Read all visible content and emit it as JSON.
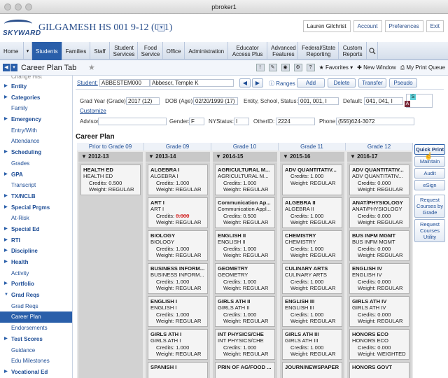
{
  "window": {
    "title": "pbroker1"
  },
  "header": {
    "app_name": "GILGAMESH HS 001 9-12 (001)",
    "logo": "SKYWARD",
    "user": "Lauren Gilchrist",
    "links": [
      "Account",
      "Preferences",
      "Exit"
    ]
  },
  "nav": {
    "tabs": [
      {
        "label": "Home",
        "active": false
      },
      {
        "label": "Students",
        "active": true
      },
      {
        "label": "Families",
        "active": false
      },
      {
        "label": "Staff",
        "active": false
      },
      {
        "label": "Student Services",
        "active": false
      },
      {
        "label": "Food Service",
        "active": false
      },
      {
        "label": "Office",
        "active": false
      },
      {
        "label": "Administration",
        "active": false
      },
      {
        "label": "Educator Access Plus",
        "active": false
      },
      {
        "label": "Advanced Features",
        "active": false
      },
      {
        "label": "Federal/State Reporting",
        "active": false
      },
      {
        "label": "Custom Reports",
        "active": false
      }
    ],
    "search_icon": "search-icon"
  },
  "pagebar": {
    "title": "Career Plan Tab",
    "favorites": "Favorites",
    "new_window": "New Window",
    "print_queue": "My Print Queue"
  },
  "sidebar": {
    "items": [
      {
        "label": "Change Hist",
        "type": "cut"
      },
      {
        "label": "Entity",
        "type": "grp"
      },
      {
        "label": "Categories",
        "type": "grp"
      },
      {
        "label": "Family",
        "type": "item"
      },
      {
        "label": "Emergency",
        "type": "grp"
      },
      {
        "label": "Entry/With",
        "type": "item"
      },
      {
        "label": "Attendance",
        "type": "item"
      },
      {
        "label": "Scheduling",
        "type": "grp"
      },
      {
        "label": "Grades",
        "type": "item"
      },
      {
        "label": "GPA",
        "type": "grp"
      },
      {
        "label": "Transcript",
        "type": "item"
      },
      {
        "label": "TX/NCLB",
        "type": "grp"
      },
      {
        "label": "Special Prgms",
        "type": "grp"
      },
      {
        "label": "At-Risk",
        "type": "item"
      },
      {
        "label": "Special Ed",
        "type": "grp"
      },
      {
        "label": "RTI",
        "type": "grp"
      },
      {
        "label": "Discipline",
        "type": "grp"
      },
      {
        "label": "Health",
        "type": "grp"
      },
      {
        "label": "Activity",
        "type": "item"
      },
      {
        "label": "Portfolio",
        "type": "grp"
      },
      {
        "label": "Grad Reqs",
        "type": "open"
      },
      {
        "label": "Grad Reqs",
        "type": "sub"
      },
      {
        "label": "Career Plan",
        "type": "sel"
      },
      {
        "label": "Endorsements",
        "type": "sub"
      },
      {
        "label": "Test Scores",
        "type": "grp"
      },
      {
        "label": "Guidance",
        "type": "item"
      },
      {
        "label": "Edu Milestones",
        "type": "item"
      },
      {
        "label": "Vocational Ed",
        "type": "grp"
      }
    ]
  },
  "student": {
    "label": "Student:",
    "id": "ABBESTEM000",
    "name": "Abbescr, Temple K",
    "ranges": "Ranges",
    "buttons": [
      "Add",
      "Delete",
      "Transfer",
      "Pseudo"
    ],
    "grad_year_label": "Grad Year (Grade):",
    "grad_year": "2017 (12)",
    "dob_label": "DOB (Age):",
    "dob": "02/20/1999 (17)",
    "entity_label": "Entity, School, Status:",
    "entity": "001, 001, I",
    "default_label": "Default:",
    "default": "041, 041, I",
    "customize": "Customize",
    "advisor_label": "Advisor:",
    "advisor": "",
    "gender_label": "Gender:",
    "gender": "F",
    "nystatus_label": "NYStatus:",
    "nystatus": "I",
    "otherid_label": "OtherID:",
    "otherid": "2224",
    "phone_label": "Phone:",
    "phone": "(555)624-3072",
    "badge_s": "S",
    "badge_a": "A"
  },
  "career_plan": {
    "title": "Career Plan",
    "columns": [
      {
        "header": "Prior to Grade 09",
        "year": "2012-13",
        "courses": [
          {
            "name": "HEALTH ED",
            "sub": "HEALTH ED",
            "credits": "0.500",
            "weight": "REGULAR",
            "strike": false
          }
        ]
      },
      {
        "header": "Grade 09",
        "year": "2013-14",
        "courses": [
          {
            "name": "ALGEBRA I",
            "sub": "ALGEBRA I",
            "credits": "1.000",
            "weight": "REGULAR",
            "strike": false
          },
          {
            "name": "ART I",
            "sub": "ART I",
            "credits": "0.000",
            "weight": "REGULAR",
            "strike": true
          },
          {
            "name": "BIOLOGY",
            "sub": "BIOLOGY",
            "credits": "1.000",
            "weight": "REGULAR",
            "strike": false
          },
          {
            "name": "BUSINESS INFORM...",
            "sub": "BUSINESS INFORM...",
            "credits": "1.000",
            "weight": "REGULAR",
            "strike": false
          },
          {
            "name": "ENGLISH I",
            "sub": "ENGLISH I",
            "credits": "1.000",
            "weight": "REGULAR",
            "strike": false
          },
          {
            "name": "GIRLS ATH I",
            "sub": "GIRLS ATH I",
            "credits": "1.000",
            "weight": "REGULAR",
            "strike": false
          },
          {
            "name": "SPANISH I",
            "sub": "",
            "credits": "",
            "weight": "",
            "strike": false
          }
        ]
      },
      {
        "header": "Grade 10",
        "year": "2014-15",
        "courses": [
          {
            "name": "AGRICULTURAL M...",
            "sub": "AGRICULTURAL M...",
            "credits": "1.000",
            "weight": "REGULAR",
            "strike": false
          },
          {
            "name": "Communication Ap...",
            "sub": "Communication Appl...",
            "credits": "0.500",
            "weight": "REGULAR",
            "strike": false
          },
          {
            "name": "ENGLISH II",
            "sub": "ENGLISH II",
            "credits": "1.000",
            "weight": "REGULAR",
            "strike": false
          },
          {
            "name": "GEOMETRY",
            "sub": "GEOMETRY",
            "credits": "1.000",
            "weight": "REGULAR",
            "strike": false
          },
          {
            "name": "GIRLS ATH II",
            "sub": "GIRLS ATH II",
            "credits": "1.000",
            "weight": "REGULAR",
            "strike": false
          },
          {
            "name": "INT PHYSICS/CHE",
            "sub": "INT PHYSICS/CHE",
            "credits": "1.000",
            "weight": "REGULAR",
            "strike": false
          },
          {
            "name": "PRIN OF AG/FOOD ...",
            "sub": "",
            "credits": "",
            "weight": "",
            "strike": false
          }
        ]
      },
      {
        "header": "Grade 11",
        "year": "2015-16",
        "courses": [
          {
            "name": "ADV QUANTITATIV...",
            "sub": "",
            "credits": "1.000",
            "weight": "REGULAR",
            "strike": false
          },
          {
            "name": "ALGEBRA II",
            "sub": "ALGEBRA II",
            "credits": "1.000",
            "weight": "REGULAR",
            "strike": false
          },
          {
            "name": "CHEMISTRY",
            "sub": "CHEMISTRY",
            "credits": "1.000",
            "weight": "REGULAR",
            "strike": false
          },
          {
            "name": "CULINARY ARTS",
            "sub": "CULINARY ARTS",
            "credits": "1.000",
            "weight": "REGULAR",
            "strike": false
          },
          {
            "name": "ENGLISH III",
            "sub": "ENGLISH III",
            "credits": "1.000",
            "weight": "REGULAR",
            "strike": false
          },
          {
            "name": "GIRLS ATH III",
            "sub": "GIRLS ATH III",
            "credits": "1.000",
            "weight": "REGULAR",
            "strike": false
          },
          {
            "name": "JOURN/NEWSPAPER",
            "sub": "",
            "credits": "",
            "weight": "",
            "strike": false
          }
        ]
      },
      {
        "header": "Grade 12",
        "year": "2016-17",
        "courses": [
          {
            "name": "ADV QUANTITATIV...",
            "sub": "ADV QUANTITATIV...",
            "credits": "0.000",
            "weight": "REGULAR",
            "strike": false
          },
          {
            "name": "ANAT/PHYSIOLOGY",
            "sub": "ANAT/PHYSIOLOGY",
            "credits": "0.000",
            "weight": "REGULAR",
            "strike": false
          },
          {
            "name": "BUS INFM MGMT",
            "sub": "BUS INFM MGMT",
            "credits": "0.000",
            "weight": "REGULAR",
            "strike": false
          },
          {
            "name": "ENGLISH IV",
            "sub": "ENGLISH IV",
            "credits": "0.000",
            "weight": "REGULAR",
            "strike": false
          },
          {
            "name": "GIRLS ATH IV",
            "sub": "GIRLS ATH IV",
            "credits": "0.000",
            "weight": "REGULAR",
            "strike": false
          },
          {
            "name": "HONORS ECO",
            "sub": "HONORS ECO",
            "credits": "0.000",
            "weight": "WEIGHTED",
            "strike": false
          },
          {
            "name": "HONORS GOVT",
            "sub": "",
            "credits": "",
            "weight": "",
            "strike": false
          }
        ]
      }
    ],
    "credits_label": "Credits:",
    "weight_label": "Weight:"
  },
  "right_buttons": [
    "Quick Print",
    "Maintain",
    "Audit",
    "eSign",
    "Request Courses by Grade",
    "Request Courses Utility"
  ],
  "colors": {
    "accent": "#2a5faa",
    "link": "#1f4e96",
    "badge_s": "#5fd0d8",
    "badge_a": "#7a2a3a"
  }
}
